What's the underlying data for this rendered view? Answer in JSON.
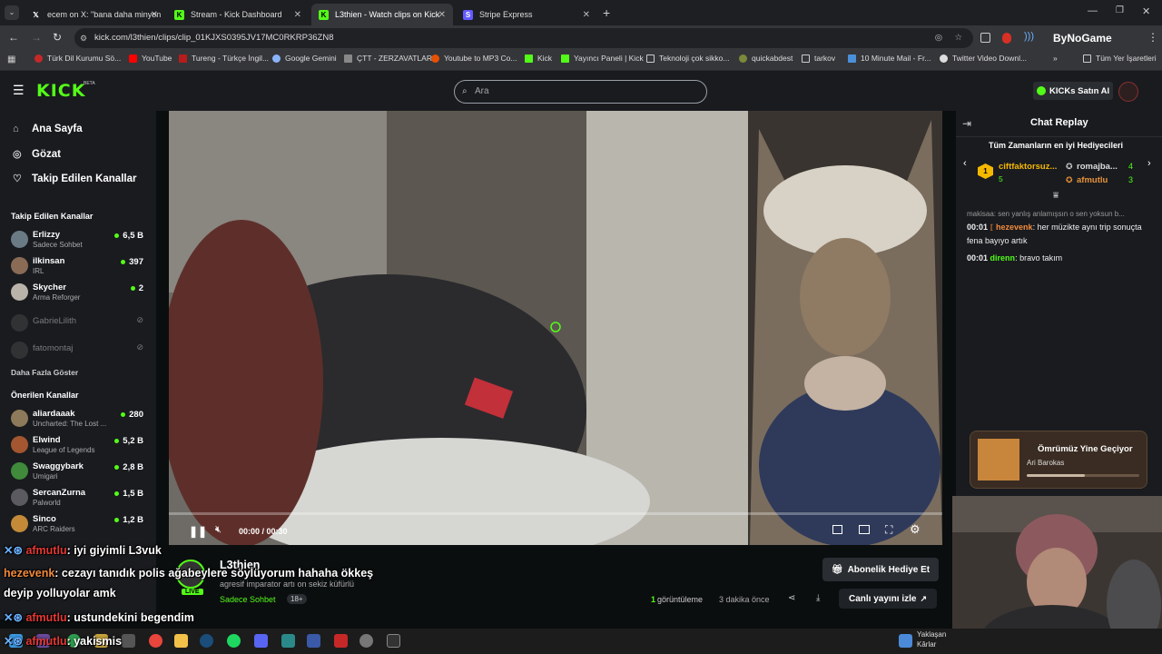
{
  "tabs": [
    {
      "title": "ecem on X: \"bana daha minyon",
      "icon": "x-icon"
    },
    {
      "title": "Stream - Kick Dashboard",
      "icon": "kick-icon"
    },
    {
      "title": "L3thien - Watch clips on Kick",
      "icon": "kick-icon",
      "active": true
    },
    {
      "title": "Stripe Express",
      "icon": "stripe-icon"
    }
  ],
  "url": "kick.com/l3thien/clips/clip_01KJXS0395JV17MC0RKRP36ZN8",
  "profile_label": "ByNoGame",
  "bookmarks": [
    "Türk Dil Kurumu Sö...",
    "YouTube",
    "Tureng - Türkçe İngil...",
    "Google Gemini",
    "ÇTT - ZERZAVATLAR",
    "Youtube to MP3 Co...",
    "Kick",
    "Yayıncı Paneli | Kick",
    "Teknoloji çok sikko...",
    "quickabdest",
    "tarkov",
    "10 Minute Mail - Fr...",
    "Twitter Video Downl..."
  ],
  "bookmarks_more": "»",
  "all_bookmarks": "Tüm Yer İşaretleri",
  "brand": {
    "logo": "KICK",
    "beta": "BETA",
    "accent": "#53fc18"
  },
  "search_placeholder": "Ara",
  "buy_kicks": "KICKs Satın Al",
  "nav": [
    {
      "label": "Ana Sayfa",
      "icon": "home-icon"
    },
    {
      "label": "Gözat",
      "icon": "compass-icon"
    },
    {
      "label": "Takip Edilen Kanallar",
      "icon": "heart-icon"
    }
  ],
  "followed_title": "Takip Edilen Kanallar",
  "followed": [
    {
      "name": "Erlizzy",
      "sub": "Sadece Sohbet",
      "viewers": "6,5 B",
      "color": "#6a7b86"
    },
    {
      "name": "ilkinsan",
      "sub": "IRL",
      "viewers": "397",
      "color": "#8a6b56"
    },
    {
      "name": "Skycher",
      "sub": "Arma Reforger",
      "viewers": "2",
      "color": "#b9b3aa"
    },
    {
      "name": "GabrieLilith",
      "sub": "",
      "viewers": "",
      "offline": true,
      "color": "#444"
    },
    {
      "name": "fatomontaj",
      "sub": "",
      "viewers": "",
      "offline": true,
      "color": "#444"
    }
  ],
  "show_more": "Daha Fazla Göster",
  "recommended_title": "Önerilen Kanallar",
  "recommended": [
    {
      "name": "aliardaaak",
      "sub": "Uncharted: The Lost ...",
      "viewers": "280",
      "color": "#8d7a5a"
    },
    {
      "name": "Elwind",
      "sub": "League of Legends",
      "viewers": "5,2 B",
      "color": "#a3562f"
    },
    {
      "name": "Swaggybark",
      "sub": "Umigari",
      "viewers": "2,8 B",
      "color": "#3f8a3b"
    },
    {
      "name": "SercanZurna",
      "sub": "Palworld",
      "viewers": "1,5 B",
      "color": "#5a5a60"
    },
    {
      "name": "Sinco",
      "sub": "ARC Raiders",
      "viewers": "1,2 B",
      "color": "#c48a38"
    }
  ],
  "player": {
    "time": "00:00 / 00:30"
  },
  "channel": {
    "name": "L3thien",
    "title": "agresif imparator artı on sekiz küfürlü",
    "category": "Sadece Sohbet",
    "age": "18+",
    "live": "LIVE"
  },
  "stats": {
    "views_num": "1",
    "views_label": "görüntüleme",
    "ago": "3 dakika önce"
  },
  "gift_sub": "Abonelik Hediye Et",
  "watch_live": "Canlı yayını izle",
  "chat": {
    "title": "Chat Replay",
    "top_title": "Tüm Zamanların en iyi Hediyecileri",
    "top": [
      {
        "name": "ciftfaktorsuz...",
        "count": "5",
        "rank": "1"
      },
      {
        "name": "romajba...",
        "count": "4"
      },
      {
        "name": "afmutlu",
        "count": "3"
      }
    ],
    "reply": "makisaa: sen yanlış anlamışsın o sen yoksun b...",
    "messages": [
      {
        "time": "00:01",
        "user": "hezevenk",
        "text": "her müzikte aynı trip sonuçta fena bayıyo artık",
        "color": "#f28a3c"
      },
      {
        "time": "00:01",
        "user": "direnn",
        "text": "bravo takım",
        "color": "#53fc18"
      }
    ]
  },
  "music": {
    "title": "Ömrümüz Yine Geçiyor",
    "artist": "Ari Barokas",
    "progress": 0.52
  },
  "overlay": [
    {
      "user": "afmutlu",
      "text": ": iyi giyimli L3vuk"
    },
    {
      "user": "hezevenk",
      "text": ": cezayı tanıdık polis ağabeylere söylüyorum hahaha ökkeş"
    },
    {
      "user": "",
      "text": "deyip yolluyolar amk"
    },
    {
      "user": "afmutlu",
      "text": ": ustundekini begendim"
    },
    {
      "user": "afmutlu",
      "text": ": yakismis"
    }
  ],
  "taskbar": {
    "weather": "Yaklaşan",
    "weather2": "Kârlar"
  }
}
